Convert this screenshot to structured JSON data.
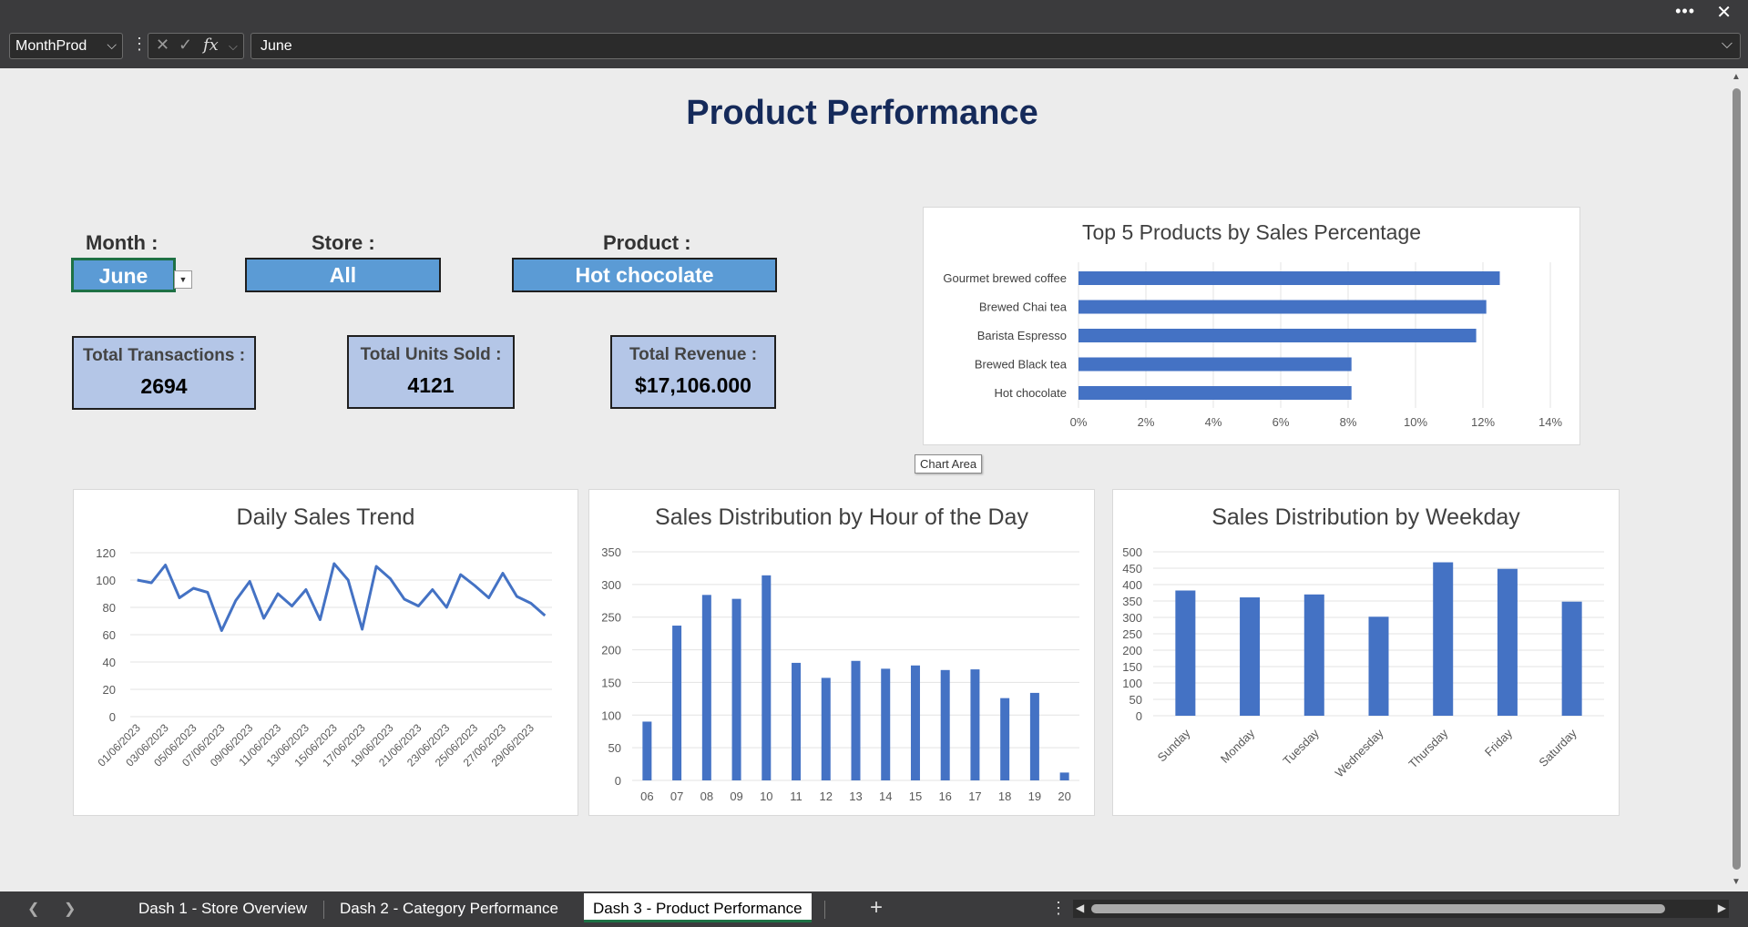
{
  "app": {
    "name_box": "MonthProd",
    "formula_value": "June",
    "fx_label": "fx"
  },
  "dashboard": {
    "title": "Product Performance",
    "filters": [
      {
        "label": "Month :",
        "value": "June"
      },
      {
        "label": "Store :",
        "value": "All"
      },
      {
        "label": "Product :",
        "value": "Hot chocolate"
      }
    ],
    "kpis": [
      {
        "label": "Total Transactions :",
        "value": "2694"
      },
      {
        "label": "Total Units Sold :",
        "value": "4121"
      },
      {
        "label": "Total Revenue :",
        "value": "$17,106.000"
      }
    ],
    "tooltip": "Chart Area"
  },
  "chart_data": [
    {
      "type": "bar",
      "orientation": "horizontal",
      "title": "Top 5 Products by Sales Percentage",
      "categories": [
        "Gourmet brewed coffee",
        "Brewed Chai tea",
        "Barista Espresso",
        "Brewed Black tea",
        "Hot chocolate"
      ],
      "values": [
        0.125,
        0.121,
        0.118,
        0.081,
        0.081
      ],
      "xlim": [
        0,
        0.14
      ],
      "xticks": [
        "0%",
        "2%",
        "4%",
        "6%",
        "8%",
        "10%",
        "12%",
        "14%"
      ],
      "grid": true,
      "color": "#4472c4"
    },
    {
      "type": "line",
      "title": "Daily Sales Trend",
      "x": [
        "01/06/2023",
        "02/06/2023",
        "03/06/2023",
        "04/06/2023",
        "05/06/2023",
        "06/06/2023",
        "07/06/2023",
        "08/06/2023",
        "09/06/2023",
        "10/06/2023",
        "11/06/2023",
        "12/06/2023",
        "13/06/2023",
        "14/06/2023",
        "15/06/2023",
        "16/06/2023",
        "17/06/2023",
        "18/06/2023",
        "19/06/2023",
        "20/06/2023",
        "21/06/2023",
        "22/06/2023",
        "23/06/2023",
        "24/06/2023",
        "25/06/2023",
        "26/06/2023",
        "27/06/2023",
        "28/06/2023",
        "29/06/2023",
        "30/06/2023"
      ],
      "xticks": [
        "01/06/2023",
        "03/06/2023",
        "05/06/2023",
        "07/06/2023",
        "09/06/2023",
        "11/06/2023",
        "13/06/2023",
        "15/06/2023",
        "17/06/2023",
        "19/06/2023",
        "21/06/2023",
        "23/06/2023",
        "25/06/2023",
        "27/06/2023",
        "29/06/2023"
      ],
      "values": [
        100,
        98,
        111,
        87,
        94,
        91,
        63,
        85,
        99,
        72,
        90,
        81,
        93,
        71,
        112,
        100,
        64,
        110,
        101,
        86,
        81,
        93,
        80,
        104,
        96,
        87,
        105,
        88,
        83,
        74
      ],
      "ylim": [
        0,
        120
      ],
      "yticks": [
        0,
        20,
        40,
        60,
        80,
        100,
        120
      ],
      "grid": true,
      "color": "#4472c4"
    },
    {
      "type": "bar",
      "title": "Sales Distribution by Hour of the Day",
      "categories": [
        "06",
        "07",
        "08",
        "09",
        "10",
        "11",
        "12",
        "13",
        "14",
        "15",
        "16",
        "17",
        "18",
        "19",
        "20"
      ],
      "values": [
        90,
        237,
        284,
        278,
        314,
        180,
        157,
        183,
        171,
        176,
        169,
        170,
        126,
        134,
        12
      ],
      "ylim": [
        0,
        350
      ],
      "yticks": [
        0,
        50,
        100,
        150,
        200,
        250,
        300,
        350
      ],
      "grid": true,
      "color": "#4472c4"
    },
    {
      "type": "bar",
      "title": "Sales Distribution by Weekday",
      "categories": [
        "Sunday",
        "Monday",
        "Tuesday",
        "Wednesday",
        "Thursday",
        "Friday",
        "Saturday"
      ],
      "values": [
        382,
        361,
        370,
        302,
        468,
        448,
        348
      ],
      "ylim": [
        0,
        500
      ],
      "yticks": [
        0,
        50,
        100,
        150,
        200,
        250,
        300,
        350,
        400,
        450,
        500
      ],
      "grid": true,
      "color": "#4472c4"
    }
  ],
  "tabs": [
    {
      "label": "Dash 1 - Store Overview"
    },
    {
      "label": "Dash 2 - Category Performance"
    },
    {
      "label": "Dash 3 - Product Performance"
    }
  ]
}
